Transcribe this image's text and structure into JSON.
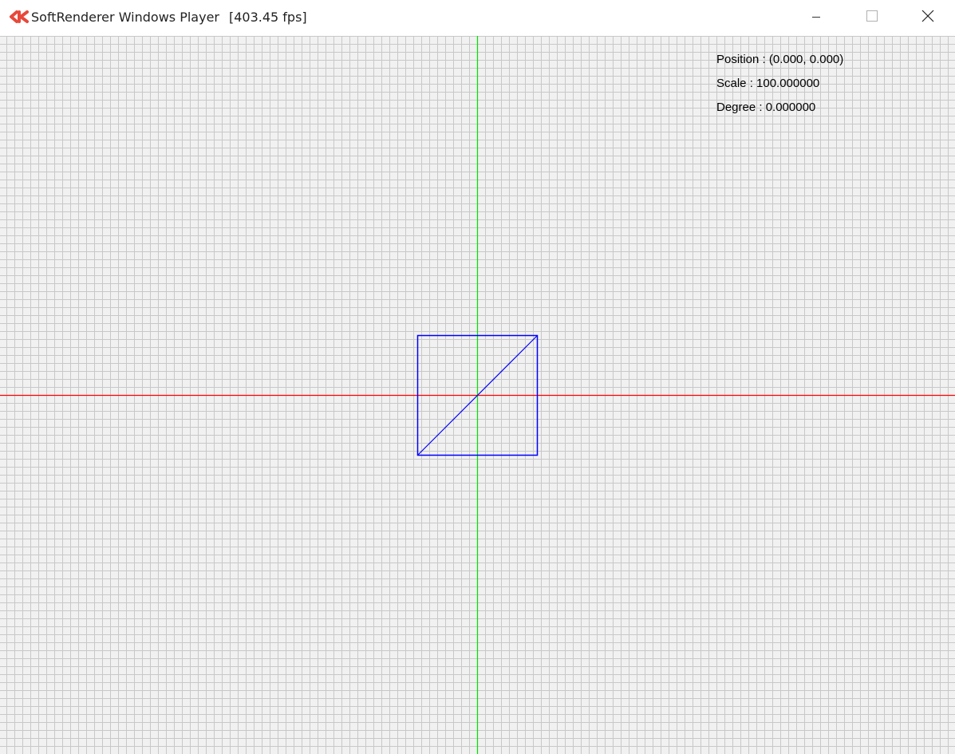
{
  "window": {
    "title": "SoftRenderer Windows Player",
    "fps": "[403.45 fps]",
    "controls": {
      "minimize_icon": "minimize-icon",
      "maximize_icon": "maximize-icon",
      "close_icon": "close-icon"
    },
    "app_icon": "ck-logo-icon"
  },
  "overlay": {
    "position": "Position : (0.000, 0.000)",
    "scale": "Scale : 100.000000",
    "degree": "Degree : 0.000000"
  },
  "scene": {
    "shape": "square with diagonal",
    "square": {
      "vertices": [
        [
          -0.5,
          0.5
        ],
        [
          0.5,
          0.5
        ],
        [
          0.5,
          -0.5
        ],
        [
          -0.5,
          -0.5
        ]
      ],
      "diagonal": [
        [
          -0.5,
          -0.5
        ],
        [
          0.5,
          0.5
        ]
      ]
    },
    "scale": 100.0,
    "colors": {
      "background": "#f1f1f1",
      "grid": "#c8c8c8",
      "x_axis": "#ff0000",
      "y_axis": "#00e000",
      "shape": "#0000ff",
      "icon": "#e8483a"
    }
  }
}
